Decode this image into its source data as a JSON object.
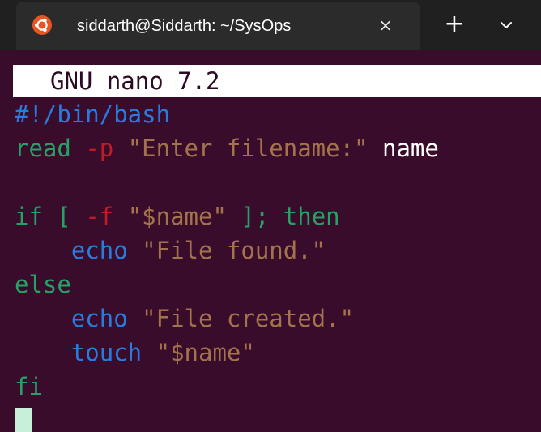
{
  "tab": {
    "title": "siddarth@Siddarth: ~/SysOps",
    "icon": "ubuntu-logo-icon",
    "close_label": "×"
  },
  "tabstrip": {
    "new_tab_label": "+",
    "dropdown_icon": "chevron-down-icon"
  },
  "nano": {
    "title": "GNU nano 7.2"
  },
  "script": {
    "line1": {
      "shebang": "#!/bin/bash"
    },
    "line2": {
      "cmd": "read",
      "opt": "-p",
      "prompt": "\"Enter filename:\"",
      "var": "name"
    },
    "line4": {
      "if": "if",
      "open": "[",
      "flag": "-f",
      "arg": "\"$name\"",
      "close": "];",
      "then": "then"
    },
    "line5": {
      "cmd": "echo",
      "msg": "\"File found.\""
    },
    "line6": {
      "else": "else"
    },
    "line7": {
      "cmd": "echo",
      "msg": "\"File created.\""
    },
    "line8": {
      "cmd": "touch",
      "arg": "\"$name\""
    },
    "line9": {
      "fi": "fi"
    }
  },
  "colors": {
    "background": "#380C2A",
    "keyword": "#26A269",
    "command": "#2A7BDE",
    "string": "#A2734C",
    "option": "#C01C28",
    "cursor": "#C8F0D8"
  }
}
